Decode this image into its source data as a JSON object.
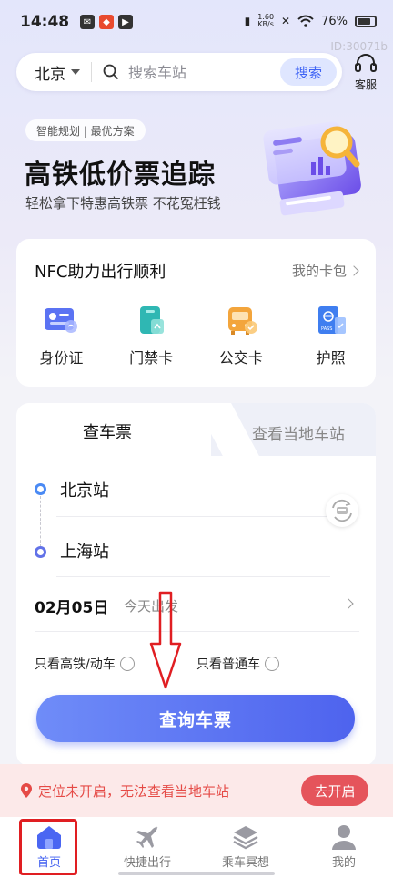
{
  "status_bar": {
    "time": "14:48",
    "net_speed_value": "1.60",
    "net_speed_unit": "KB/s",
    "battery": "76%"
  },
  "watermark": "ID:30071b",
  "search": {
    "city": "北京",
    "placeholder": "搜索车站",
    "button": "搜索"
  },
  "customer_service": {
    "label": "客服"
  },
  "banner": {
    "chip": "智能规划 | 最优方案",
    "title": "高铁低价票追踪",
    "subtitle": "轻松拿下特惠高铁票 不花冤枉钱"
  },
  "nfc": {
    "title": "NFC助力出行顺利",
    "link": "我的卡包",
    "items": [
      {
        "label": "身份证",
        "icon": "id-card-icon"
      },
      {
        "label": "门禁卡",
        "icon": "access-card-icon"
      },
      {
        "label": "公交卡",
        "icon": "bus-card-icon"
      },
      {
        "label": "护照",
        "icon": "passport-icon"
      }
    ]
  },
  "ticket": {
    "tabs": [
      "查车票",
      "查看当地车站"
    ],
    "from_station": "北京站",
    "to_station": "上海站",
    "date": "02月05日",
    "date_note": "今天出发",
    "option_hsr": "只看高铁/动车",
    "option_normal": "只看普通车",
    "query_button": "查询车票"
  },
  "location_notice": {
    "text": "定位未开启，无法查看当地车站",
    "button": "去开启"
  },
  "nav": {
    "items": [
      {
        "label": "首页",
        "active": true
      },
      {
        "label": "快捷出行",
        "active": false
      },
      {
        "label": "乘车冥想",
        "active": false
      },
      {
        "label": "我的",
        "active": false
      }
    ]
  },
  "colors": {
    "accent": "#4e63ee",
    "alert": "#e5545b",
    "annotation": "#e01e22"
  }
}
